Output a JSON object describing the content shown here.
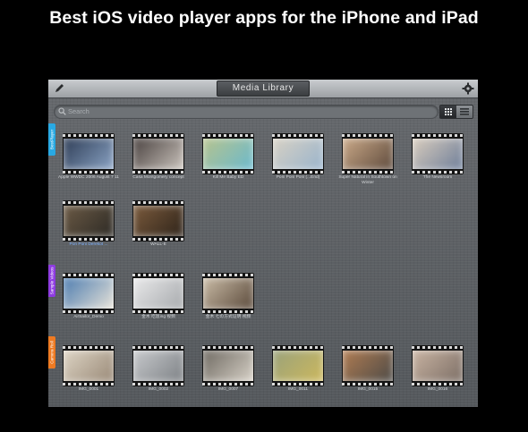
{
  "headline": "Best iOS video player apps for the iPhone and iPad",
  "toolbar": {
    "title": "Media Library",
    "edit_icon": "pen-icon",
    "settings_icon": "gear-icon"
  },
  "search": {
    "placeholder": "Search"
  },
  "view_toggle": {
    "grid_icon": "grid-icon",
    "list_icon": "list-icon"
  },
  "sections": [
    {
      "tab_label": "BestPlayer",
      "color": "#29a9e3"
    },
    {
      "tab_label": "Sample Videos",
      "color": "#8e3ce0"
    },
    {
      "tab_label": "Camera Roll",
      "color": "#ee7a22"
    }
  ],
  "videos": [
    {
      "caption": "Apple WWDC 2006 August 7 11",
      "colors": [
        "#2e3d56",
        "#8aa3c4"
      ]
    },
    {
      "caption": "Casa Montgomery concept",
      "colors": [
        "#4a4240",
        "#c9c2bb"
      ]
    },
    {
      "caption": "Kill Me Baby ED",
      "colors": [
        "#b6c38e",
        "#6bb9cc"
      ]
    },
    {
      "caption": "Poni Poni Poni (...End)",
      "colors": [
        "#d7d1c4",
        "#9ab4cc"
      ]
    },
    {
      "caption": "Super Natural in Southtown on Winter",
      "colors": [
        "#caa988",
        "#5f4b3d"
      ]
    },
    {
      "caption": "The Newsroom",
      "colors": [
        "#d8ccbd",
        "#6f7f9a"
      ]
    },
    {
      "caption": "Pon Poni Derekot ...",
      "colors": [
        "#6b5a45",
        "#2d2a25"
      ],
      "highlight": true
    },
    {
      "caption": "WALL-E",
      "colors": [
        "#7a5a3c",
        "#2f241a"
      ]
    },
    {
      "caption": "AirSailor_Demo",
      "colors": [
        "#4e7db0",
        "#e6e2d8"
      ]
    },
    {
      "caption": "金木 吃饭ing 视频",
      "colors": [
        "#e9e9ea",
        "#a7aaad"
      ]
    },
    {
      "caption": "金木 七の方式证明 视频",
      "colors": [
        "#c9bba6",
        "#5b4a3b"
      ]
    },
    {
      "caption": "IMG_0001",
      "colors": [
        "#ddd4c4",
        "#9a8a78"
      ]
    },
    {
      "caption": "IMG_0002",
      "colors": [
        "#c7c9cc",
        "#7e8286"
      ]
    },
    {
      "caption": "IMG_0007",
      "colors": [
        "#6f6a62",
        "#d6d0c6"
      ]
    },
    {
      "caption": "IMG_0011",
      "colors": [
        "#9aa27a",
        "#ccb85e"
      ]
    },
    {
      "caption": "IMG_0015",
      "colors": [
        "#b07c52",
        "#4e4b47"
      ]
    },
    {
      "caption": "IMG_0016",
      "colors": [
        "#c8b3a2",
        "#7d6f66"
      ]
    }
  ]
}
